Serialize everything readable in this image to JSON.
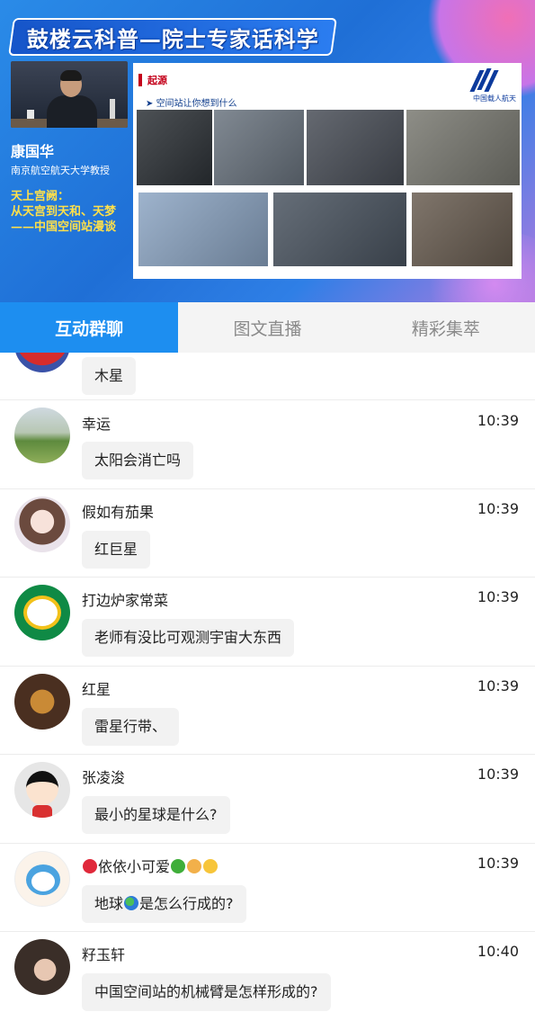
{
  "video": {
    "banner_title": "鼓楼云科普—院士专家话科学",
    "presenter_name": "康国华",
    "presenter_org": "南京航空航天大学教授",
    "topic_line1": "天上宫阙：",
    "topic_line2": "从天宫到天和、天梦",
    "topic_line3": "——中国空间站漫谈",
    "slide": {
      "section_title": "起源",
      "subtitle": "空间站让你想到什么",
      "logo_text": "中国载人航天"
    }
  },
  "tabs": [
    {
      "label": "互动群聊",
      "active": true
    },
    {
      "label": "图文直播",
      "active": false
    },
    {
      "label": "精彩集萃",
      "active": false
    }
  ],
  "messages": [
    {
      "user": "",
      "time": "",
      "text": "木星",
      "avatar": "red-cartoon-avatar"
    },
    {
      "user": "幸运",
      "time": "10:39",
      "text": "太阳会消亡吗",
      "avatar": "tree-photo-avatar"
    },
    {
      "user": "假如有茄果",
      "time": "10:39",
      "text": "红巨星",
      "avatar": "anime-girl-avatar"
    },
    {
      "user": "打边炉家常菜",
      "time": "10:39",
      "text": "老师有没比可观测宇宙大东西",
      "avatar": "green-logo-avatar"
    },
    {
      "user": "红星",
      "time": "10:39",
      "text": "雷星行带、",
      "avatar": "cat-figure-avatar"
    },
    {
      "user": "张凌浚",
      "time": "10:39",
      "text": "最小的星球是什么?",
      "avatar": "cartoon-kid-avatar"
    },
    {
      "user_prefix": "依依小可爱",
      "time": "10:39",
      "text_prefix": "地球",
      "text_suffix": "是怎么行成的?",
      "avatar": "doraemon-avatar"
    },
    {
      "user": "籽玉轩",
      "time": "10:40",
      "text": "中国空间站的机械臂是怎样形成的?",
      "avatar": "hand-photo-avatar"
    }
  ],
  "colors": {
    "accent_blue": "#1d8ef0",
    "topic_yellow": "#ffe04a",
    "slide_red": "#c4001a"
  }
}
